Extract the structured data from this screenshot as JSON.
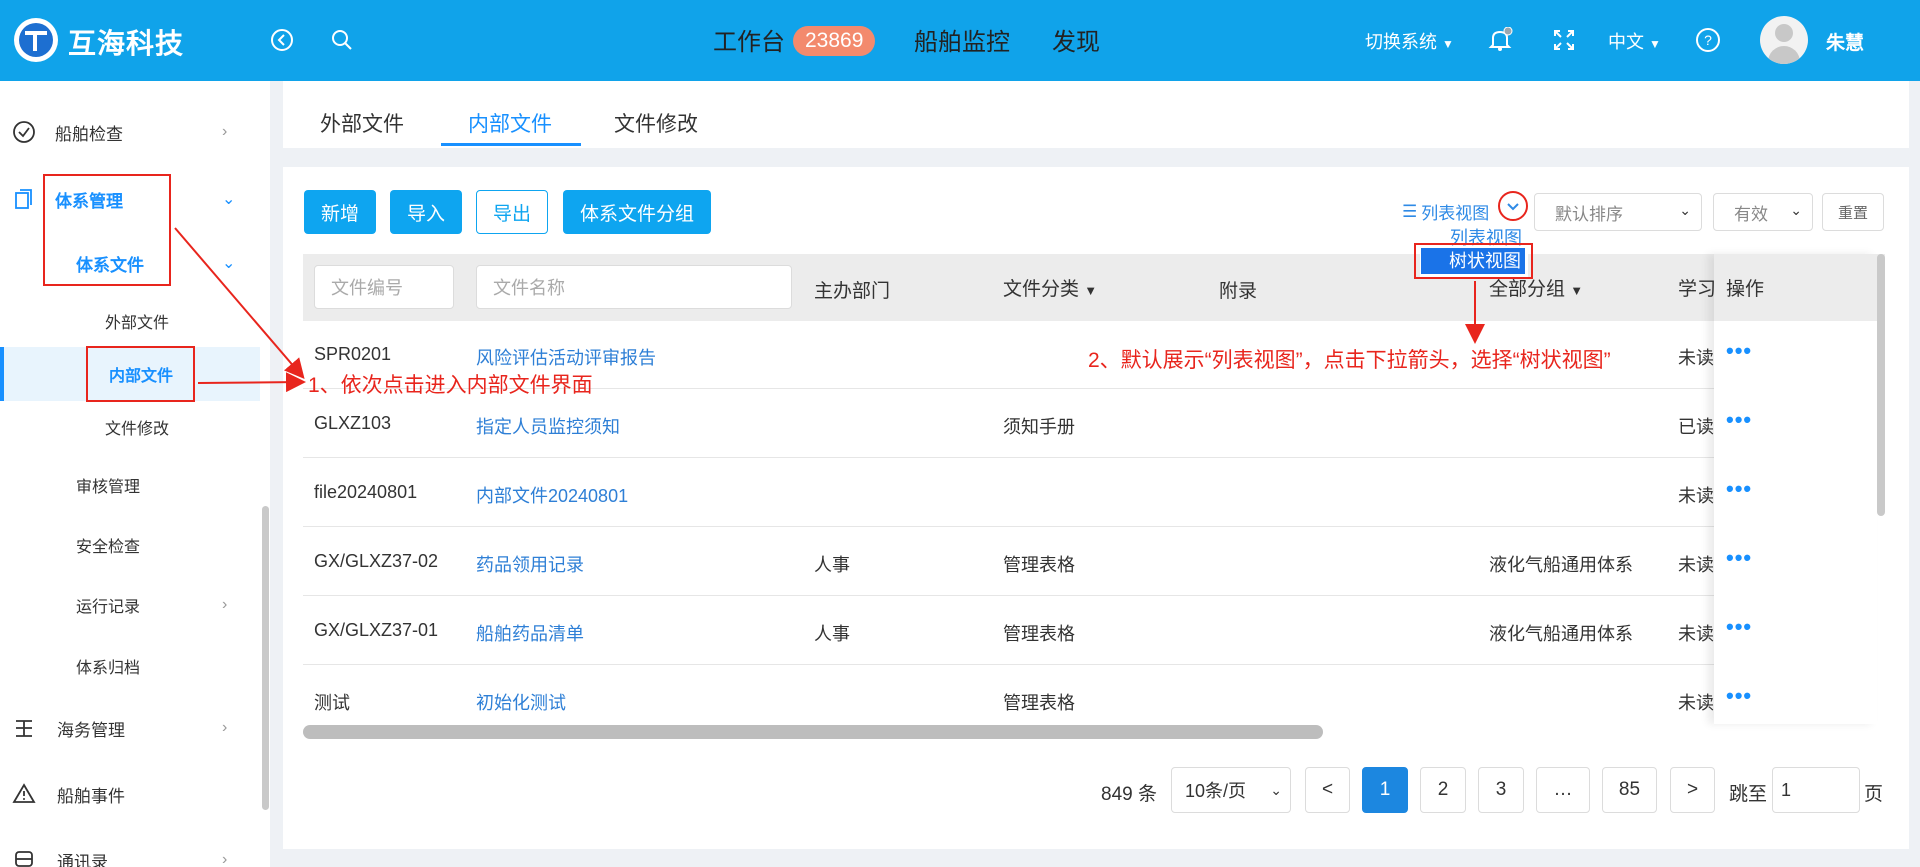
{
  "header": {
    "brand": "互海科技",
    "nav": [
      {
        "label": "工作台"
      },
      {
        "label": "船舶监控"
      },
      {
        "label": "发现"
      }
    ],
    "badge_count": "23869",
    "switch_system": "切换系统",
    "language": "中文",
    "user_name": "朱慧"
  },
  "sidebar": {
    "items": [
      {
        "label": "船舶检查"
      },
      {
        "label": "体系管理"
      },
      {
        "label": "体系文件"
      },
      {
        "label": "外部文件"
      },
      {
        "label": "内部文件"
      },
      {
        "label": "文件修改"
      },
      {
        "label": "审核管理"
      },
      {
        "label": "安全检查"
      },
      {
        "label": "运行记录"
      },
      {
        "label": "体系归档"
      },
      {
        "label": "海务管理"
      },
      {
        "label": "船舶事件"
      },
      {
        "label": "通讯录"
      }
    ]
  },
  "tabs": [
    {
      "label": "外部文件"
    },
    {
      "label": "内部文件"
    },
    {
      "label": "文件修改"
    }
  ],
  "toolbar": {
    "add": "新增",
    "import": "导入",
    "export": "导出",
    "group": "体系文件分组",
    "view_label": "列表视图",
    "view_options": [
      "列表视图",
      "树状视图"
    ],
    "sort_value": "默认排序",
    "status_value": "有效",
    "reset": "重置"
  },
  "table": {
    "filters": {
      "code_placeholder": "文件编号",
      "name_placeholder": "文件名称"
    },
    "headers": {
      "dept": "主办部门",
      "category": "文件分类",
      "appendix": "附录",
      "group": "全部分组",
      "study": "学习",
      "ops": "操作"
    },
    "rows": [
      {
        "code": "SPR0201",
        "name": "风险评估活动评审报告",
        "dept": "",
        "category": "",
        "group": "",
        "study": "未读"
      },
      {
        "code": "GLXZ103",
        "name": "指定人员监控须知",
        "dept": "",
        "category": "须知手册",
        "group": "",
        "study": "已读"
      },
      {
        "code": "file20240801",
        "name": "内部文件20240801",
        "dept": "",
        "category": "",
        "group": "",
        "study": "未读"
      },
      {
        "code": "GX/GLXZ37-02",
        "name": "药品领用记录",
        "dept": "人事",
        "category": "管理表格",
        "group": "液化气船通用体系",
        "study": "未读"
      },
      {
        "code": "GX/GLXZ37-01",
        "name": "船舶药品清单",
        "dept": "人事",
        "category": "管理表格",
        "group": "液化气船通用体系",
        "study": "未读"
      },
      {
        "code": "测试",
        "name": "初始化测试",
        "dept": "",
        "category": "管理表格",
        "group": "",
        "study": "未读"
      }
    ],
    "ops_glyph": "•••"
  },
  "pagination": {
    "total": "849 条",
    "page_size": "10条/页",
    "prev": "<",
    "pages": [
      "1",
      "2",
      "3",
      "…",
      "85"
    ],
    "next": ">",
    "jump_label": "跳至",
    "jump_value": "1",
    "page_suffix": "页"
  },
  "annotations": {
    "step1": "1、依次点击进入内部文件界面",
    "step2": "2、默认展示“列表视图”，点击下拉箭头，选择“树状视图”"
  },
  "colors": {
    "header_bg": "#10a3ea",
    "primary": "#0ea5f0",
    "annotation": "#e8251d",
    "active_page": "#1c87e0"
  },
  "icons": [
    "back-circle-icon",
    "search-icon",
    "bell-icon",
    "fullscreen-icon",
    "help-icon",
    "list-view-icon",
    "check-circle-icon",
    "document-icon",
    "anchor-icon",
    "warning-icon",
    "bus-icon"
  ]
}
